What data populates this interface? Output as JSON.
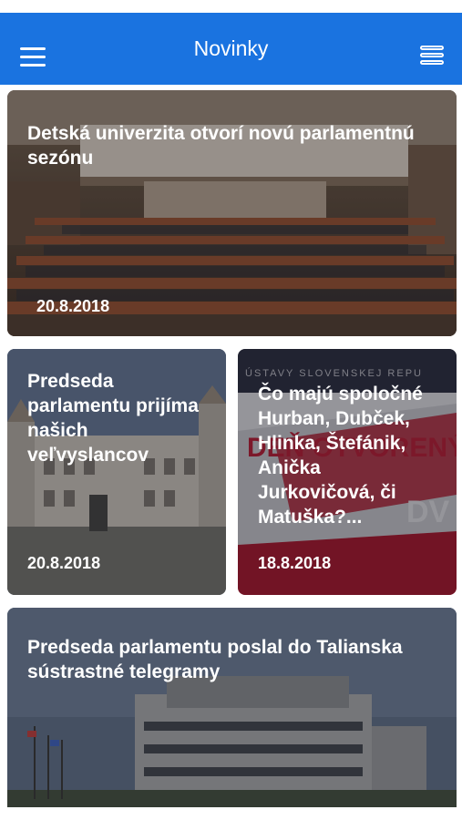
{
  "header": {
    "title": "Novinky",
    "menu_icon": "hamburger-menu-icon",
    "list_icon": "list-view-icon",
    "background": "#1a73e0"
  },
  "articles": [
    {
      "title": "Detská univerzita otvorí novú parlamentnú sezónu",
      "date": "20.8.2018"
    },
    {
      "title": "Predseda parlamentu prijíma našich veľvyslancov",
      "date": "20.8.2018"
    },
    {
      "title": "Čo majú spoločné Hurban, Dubček, Hlinka, Štefánik, Anička Jurkovičová, či Matuška?...",
      "date": "18.8.2018",
      "banner_text_top": "ÚSTAVY SLOVENSKEJ REPU",
      "banner_text_mid": "DEŇ OTVORENÝCH",
      "banner_text_bottom": "DV"
    },
    {
      "title": "Predseda parlamentu poslal do Talianska sústrastné telegramy"
    }
  ]
}
